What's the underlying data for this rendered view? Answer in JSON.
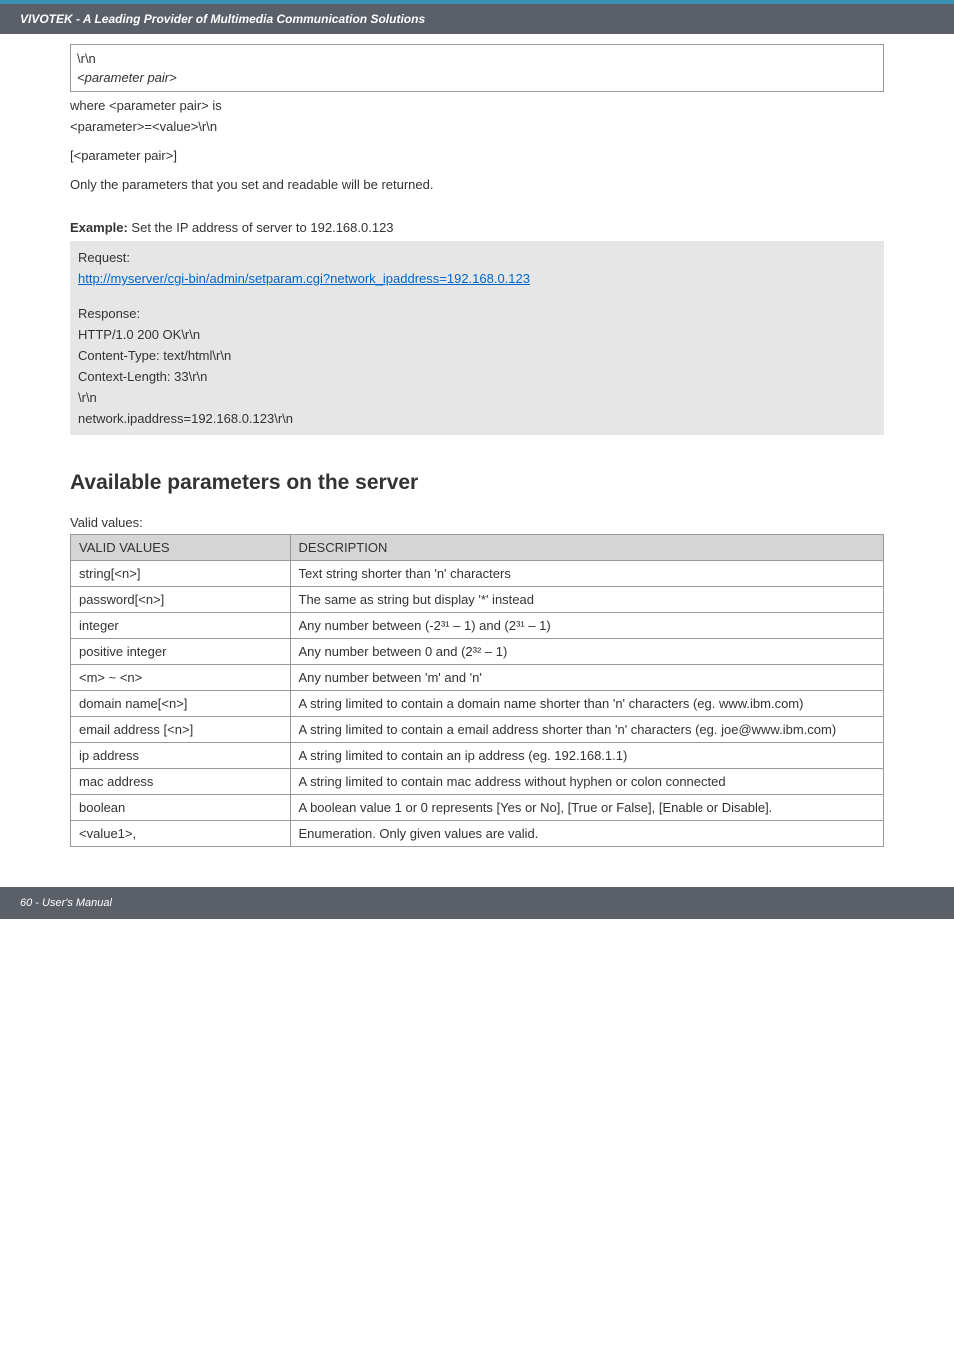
{
  "header": {
    "title": "VIVOTEK - A Leading Provider of Multimedia Communication Solutions"
  },
  "codebox": {
    "line1": "\\r\\n",
    "line2": "<parameter pair>"
  },
  "plain": {
    "where": "where <parameter pair> is",
    "param_eq": "<parameter>=<value>\\r\\n",
    "param_pair_br": "[<parameter pair>]",
    "only_params": "Only the parameters that you set and readable will be returned."
  },
  "example": {
    "label": "Example:",
    "text": " Set the IP address of server to 192.168.0.123"
  },
  "request_block": {
    "request_label": "Request:",
    "url": "http://myserver/cgi-bin/admin/setparam.cgi?network_ipaddress=192.168.0.123",
    "response_label": "Response:",
    "line1": "HTTP/1.0 200 OK\\r\\n",
    "line2": "Content-Type: text/html\\r\\n",
    "line3": "Context-Length: 33\\r\\n",
    "line4": "\\r\\n",
    "line5": "network.ipaddress=192.168.0.123\\r\\n"
  },
  "section": {
    "heading": "Available parameters on the server",
    "valid_label": "Valid values:"
  },
  "table": {
    "head1": "VALID VALUES",
    "head2": "DESCRIPTION",
    "rows": [
      {
        "c1": "string[<n>]",
        "c2": "Text string shorter than 'n' characters"
      },
      {
        "c1": "password[<n>]",
        "c2": "The same as string but display '*' instead"
      },
      {
        "c1": "integer",
        "c2": "Any number between (-2³¹ – 1) and (2³¹ – 1)"
      },
      {
        "c1": "positive integer",
        "c2": "Any number between 0 and (2³² – 1)"
      },
      {
        "c1": "<m> ~ <n>",
        "c2": "Any number between 'm' and 'n'"
      },
      {
        "c1": "domain name[<n>]",
        "c2": "A string limited to contain a domain name shorter than 'n' characters (eg. www.ibm.com)"
      },
      {
        "c1": "email address [<n>]",
        "c2": "A string limited to contain a email address shorter than 'n' characters (eg. joe@www.ibm.com)"
      },
      {
        "c1": "ip address",
        "c2": "A string limited to contain an ip address (eg. 192.168.1.1)"
      },
      {
        "c1": "mac address",
        "c2": "A string limited to contain mac address without hyphen or colon connected"
      },
      {
        "c1": "boolean",
        "c2": "A boolean value 1 or 0 represents [Yes or No], [True or False], [Enable or Disable]."
      },
      {
        "c1": "<value1>,",
        "c2": "Enumeration. Only given values are valid."
      }
    ]
  },
  "footer": {
    "text": "60 - User's Manual"
  }
}
